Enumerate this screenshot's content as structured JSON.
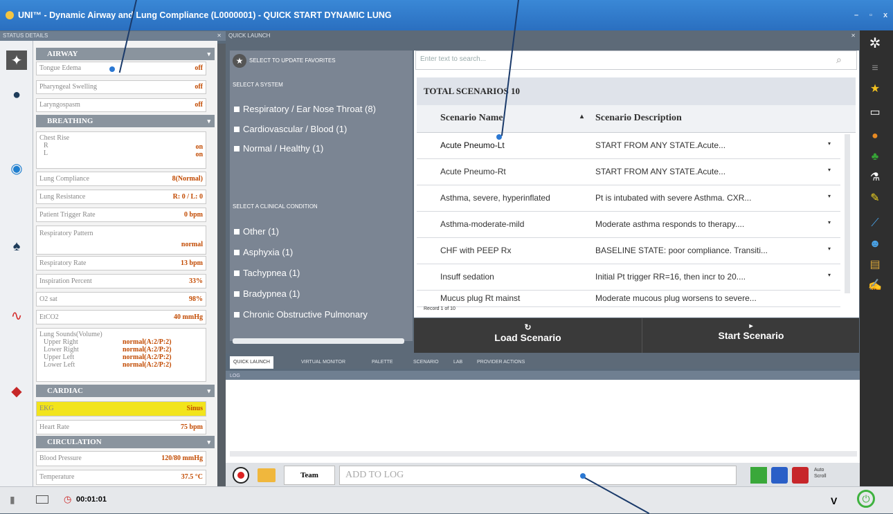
{
  "window": {
    "title": "UNI™ - Dynamic Airway and Lung Compliance (L0000001) - QUICK START DYNAMIC LUNG",
    "min": "–",
    "max": "▫",
    "close": "x"
  },
  "status_panel": {
    "title": "STATUS DETAILS",
    "airway": {
      "label": "AIRWAY",
      "rows": [
        {
          "label": "Tongue Edema",
          "value": "off"
        },
        {
          "label": "Pharyngeal Swelling",
          "value": "off"
        },
        {
          "label": "Laryngospasm",
          "value": "off"
        }
      ]
    },
    "breathing": {
      "label": "BREATHING",
      "chest_rise": "Chest Rise",
      "r_label": "R",
      "r_value": "on",
      "l_label": "L",
      "l_value": "on",
      "rows": [
        {
          "label": "Lung Compliance",
          "value": "8(Normal)"
        },
        {
          "label": "Lung Resistance",
          "value": "R: 0 / L: 0"
        },
        {
          "label": "Patient Trigger Rate",
          "value": "0 bpm"
        }
      ],
      "resp_pattern": "Respiratory Pattern",
      "resp_pattern_value": "normal",
      "rows2": [
        {
          "label": "Respiratory Rate",
          "value": "13 bpm"
        },
        {
          "label": "Inspiration Percent",
          "value": "33%"
        },
        {
          "label": "O2 sat",
          "value": "98%"
        },
        {
          "label": "EtCO2",
          "value": "40 mmHg"
        }
      ],
      "lung_sounds": "Lung Sounds(Volume)",
      "sounds": [
        {
          "label": "Upper Right",
          "value": "normal(A:2/P:2)"
        },
        {
          "label": "Lower Right",
          "value": "normal(A:2/P:2)"
        },
        {
          "label": "Upper Left",
          "value": "normal(A:2/P:2)"
        },
        {
          "label": "Lower Left",
          "value": "normal(A:2/P:2)"
        }
      ]
    },
    "cardiac": {
      "label": "CARDIAC",
      "rows": [
        {
          "label": "EKG",
          "value": "Sinus"
        },
        {
          "label": "Heart Rate",
          "value": "75 bpm"
        }
      ]
    },
    "circulation": {
      "label": "CIRCULATION",
      "rows": [
        {
          "label": "Blood Pressure",
          "value": "120/80 mmHg"
        },
        {
          "label": "Temperature",
          "value": "37.5 °C"
        }
      ]
    }
  },
  "quick_launch": {
    "title": "QUICK LAUNCH",
    "favorites": "SELECT TO UPDATE FAVORITES",
    "select_system": "SELECT A SYSTEM",
    "systems": [
      "Respiratory / Ear Nose Throat (8)",
      "Cardiovascular / Blood (1)",
      "Normal / Healthy (1)"
    ],
    "select_condition": "SELECT A CLINICAL CONDITION",
    "conditions": [
      "Other (1)",
      "Asphyxia (1)",
      "Tachypnea (1)",
      "Bradypnea (1)",
      "Chronic Obstructive Pulmonary"
    ],
    "search_placeholder": "Enter text to search...",
    "total": "TOTAL SCENARIOS 10",
    "col_name": "Scenario Name",
    "col_desc": "Scenario Description",
    "rows": [
      {
        "name": "Acute Pneumo-Lt",
        "desc": "START FROM ANY STATE.Acute..."
      },
      {
        "name": "Acute Pneumo-Rt",
        "desc": "START FROM ANY STATE.Acute..."
      },
      {
        "name": "Asthma, severe, hyperinflated",
        "desc": "Pt is intubated with severe Asthma. CXR..."
      },
      {
        "name": "Asthma-moderate-mild",
        "desc": "Moderate asthma responds to therapy...."
      },
      {
        "name": "CHF with PEEP Rx",
        "desc": "BASELINE STATE: poor compliance. Transiti..."
      },
      {
        "name": "Insuff sedation",
        "desc": "Initial Pt trigger RR=16, then incr to 20...."
      },
      {
        "name": "Mucus plug Rt mainst",
        "desc": "Moderate mucous plug worsens to severe..."
      }
    ],
    "record": "Record 1 of 10",
    "load": "Load Scenario",
    "start": "Start Scenario"
  },
  "tabs": [
    "QUICK LAUNCH",
    "VIRTUAL MONITOR",
    "PALETTE",
    "SCENARIO",
    "LAB",
    "PROVIDER ACTIONS"
  ],
  "log": {
    "title": "LOG",
    "team": "Team",
    "placeholder": "ADD TO LOG",
    "auto_scroll": "Auto Scroll"
  },
  "statusbar": {
    "timer": "00:01:01",
    "version": "V"
  }
}
